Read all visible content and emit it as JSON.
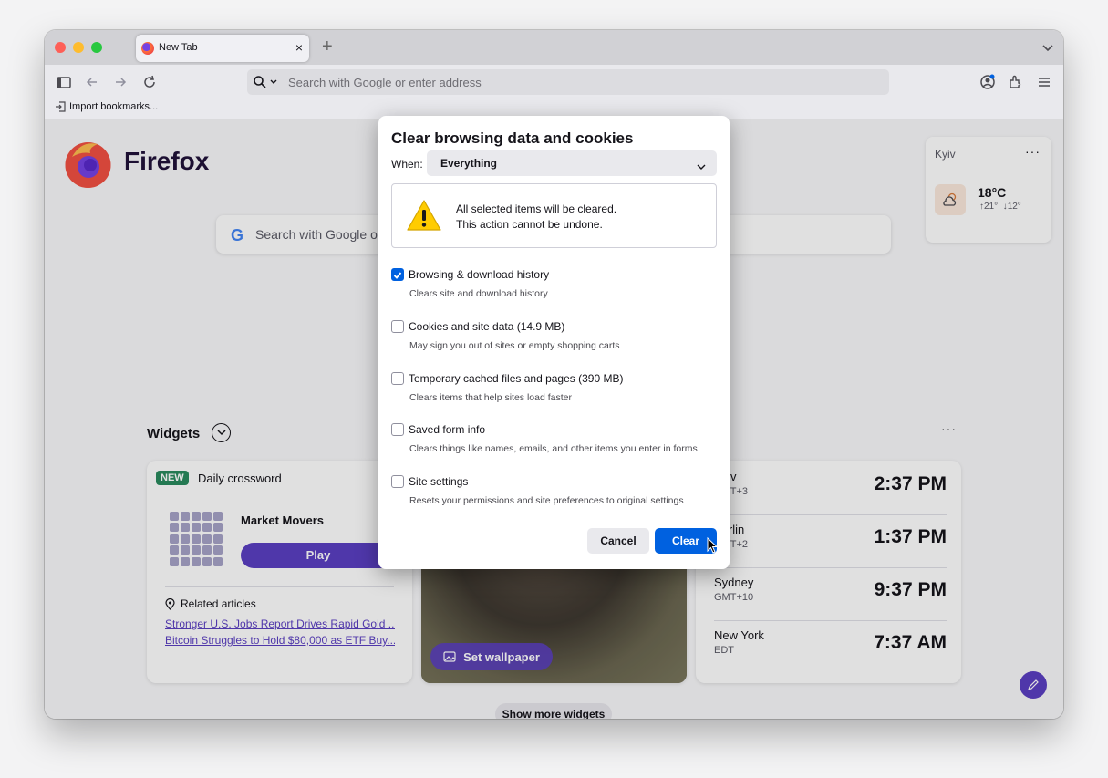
{
  "tabs": [
    {
      "title": "New Tab",
      "close": "×"
    }
  ],
  "tabstrip": {
    "new_tab": "+"
  },
  "urlbar": {
    "placeholder": "Search with Google or enter address"
  },
  "bookmarks": {
    "import_label": "Import bookmarks..."
  },
  "newtab": {
    "logo_text": "Firefox",
    "search_placeholder": "Search with Google or",
    "weather": {
      "city": "Kyiv",
      "more": "···",
      "temp": "18°C",
      "high": "21°",
      "low": "12°"
    },
    "widgets": {
      "title": "Widgets",
      "more": "···",
      "crossword": {
        "badge": "NEW",
        "title": "Daily crossword",
        "puzzle_name": "Market Movers",
        "play_label": "Play",
        "related_label": "Related articles",
        "articles": [
          "Stronger U.S. Jobs Report Drives Rapid Gold ...",
          "Bitcoin Struggles to Hold $80,000 as ETF Buy..."
        ]
      },
      "wallpaper": {
        "set_label": "Set wallpaper"
      },
      "clocks": [
        {
          "city": "Kyiv",
          "tz": "GMT+3",
          "time": "2:37 PM"
        },
        {
          "city": "Berlin",
          "tz": "GMT+2",
          "time": "1:37 PM"
        },
        {
          "city": "Sydney",
          "tz": "GMT+10",
          "time": "9:37 PM"
        },
        {
          "city": "New York",
          "tz": "EDT",
          "time": "7:37 AM"
        }
      ],
      "show_more_label": "Show more widgets"
    }
  },
  "dialog": {
    "title": "Clear browsing data and cookies",
    "when_label": "When:",
    "when_value": "Everything",
    "warning_line1": "All selected items will be cleared.",
    "warning_line2": "This action cannot be undone.",
    "options": [
      {
        "label": "Browsing & download history",
        "desc": "Clears site and download history",
        "checked": true
      },
      {
        "label": "Cookies and site data (14.9 MB)",
        "desc": "May sign you out of sites or empty shopping carts",
        "checked": false
      },
      {
        "label": "Temporary cached files and pages (390 MB)",
        "desc": "Clears items that help sites load faster",
        "checked": false
      },
      {
        "label": "Saved form info",
        "desc": "Clears things like names, emails, and other items you enter in forms",
        "checked": false
      },
      {
        "label": "Site settings",
        "desc": "Resets your permissions and site preferences to original settings",
        "checked": false
      }
    ],
    "cancel_label": "Cancel",
    "clear_label": "Clear"
  },
  "colors": {
    "accent": "#0061e0",
    "brand_purple": "#5b3fc2"
  }
}
